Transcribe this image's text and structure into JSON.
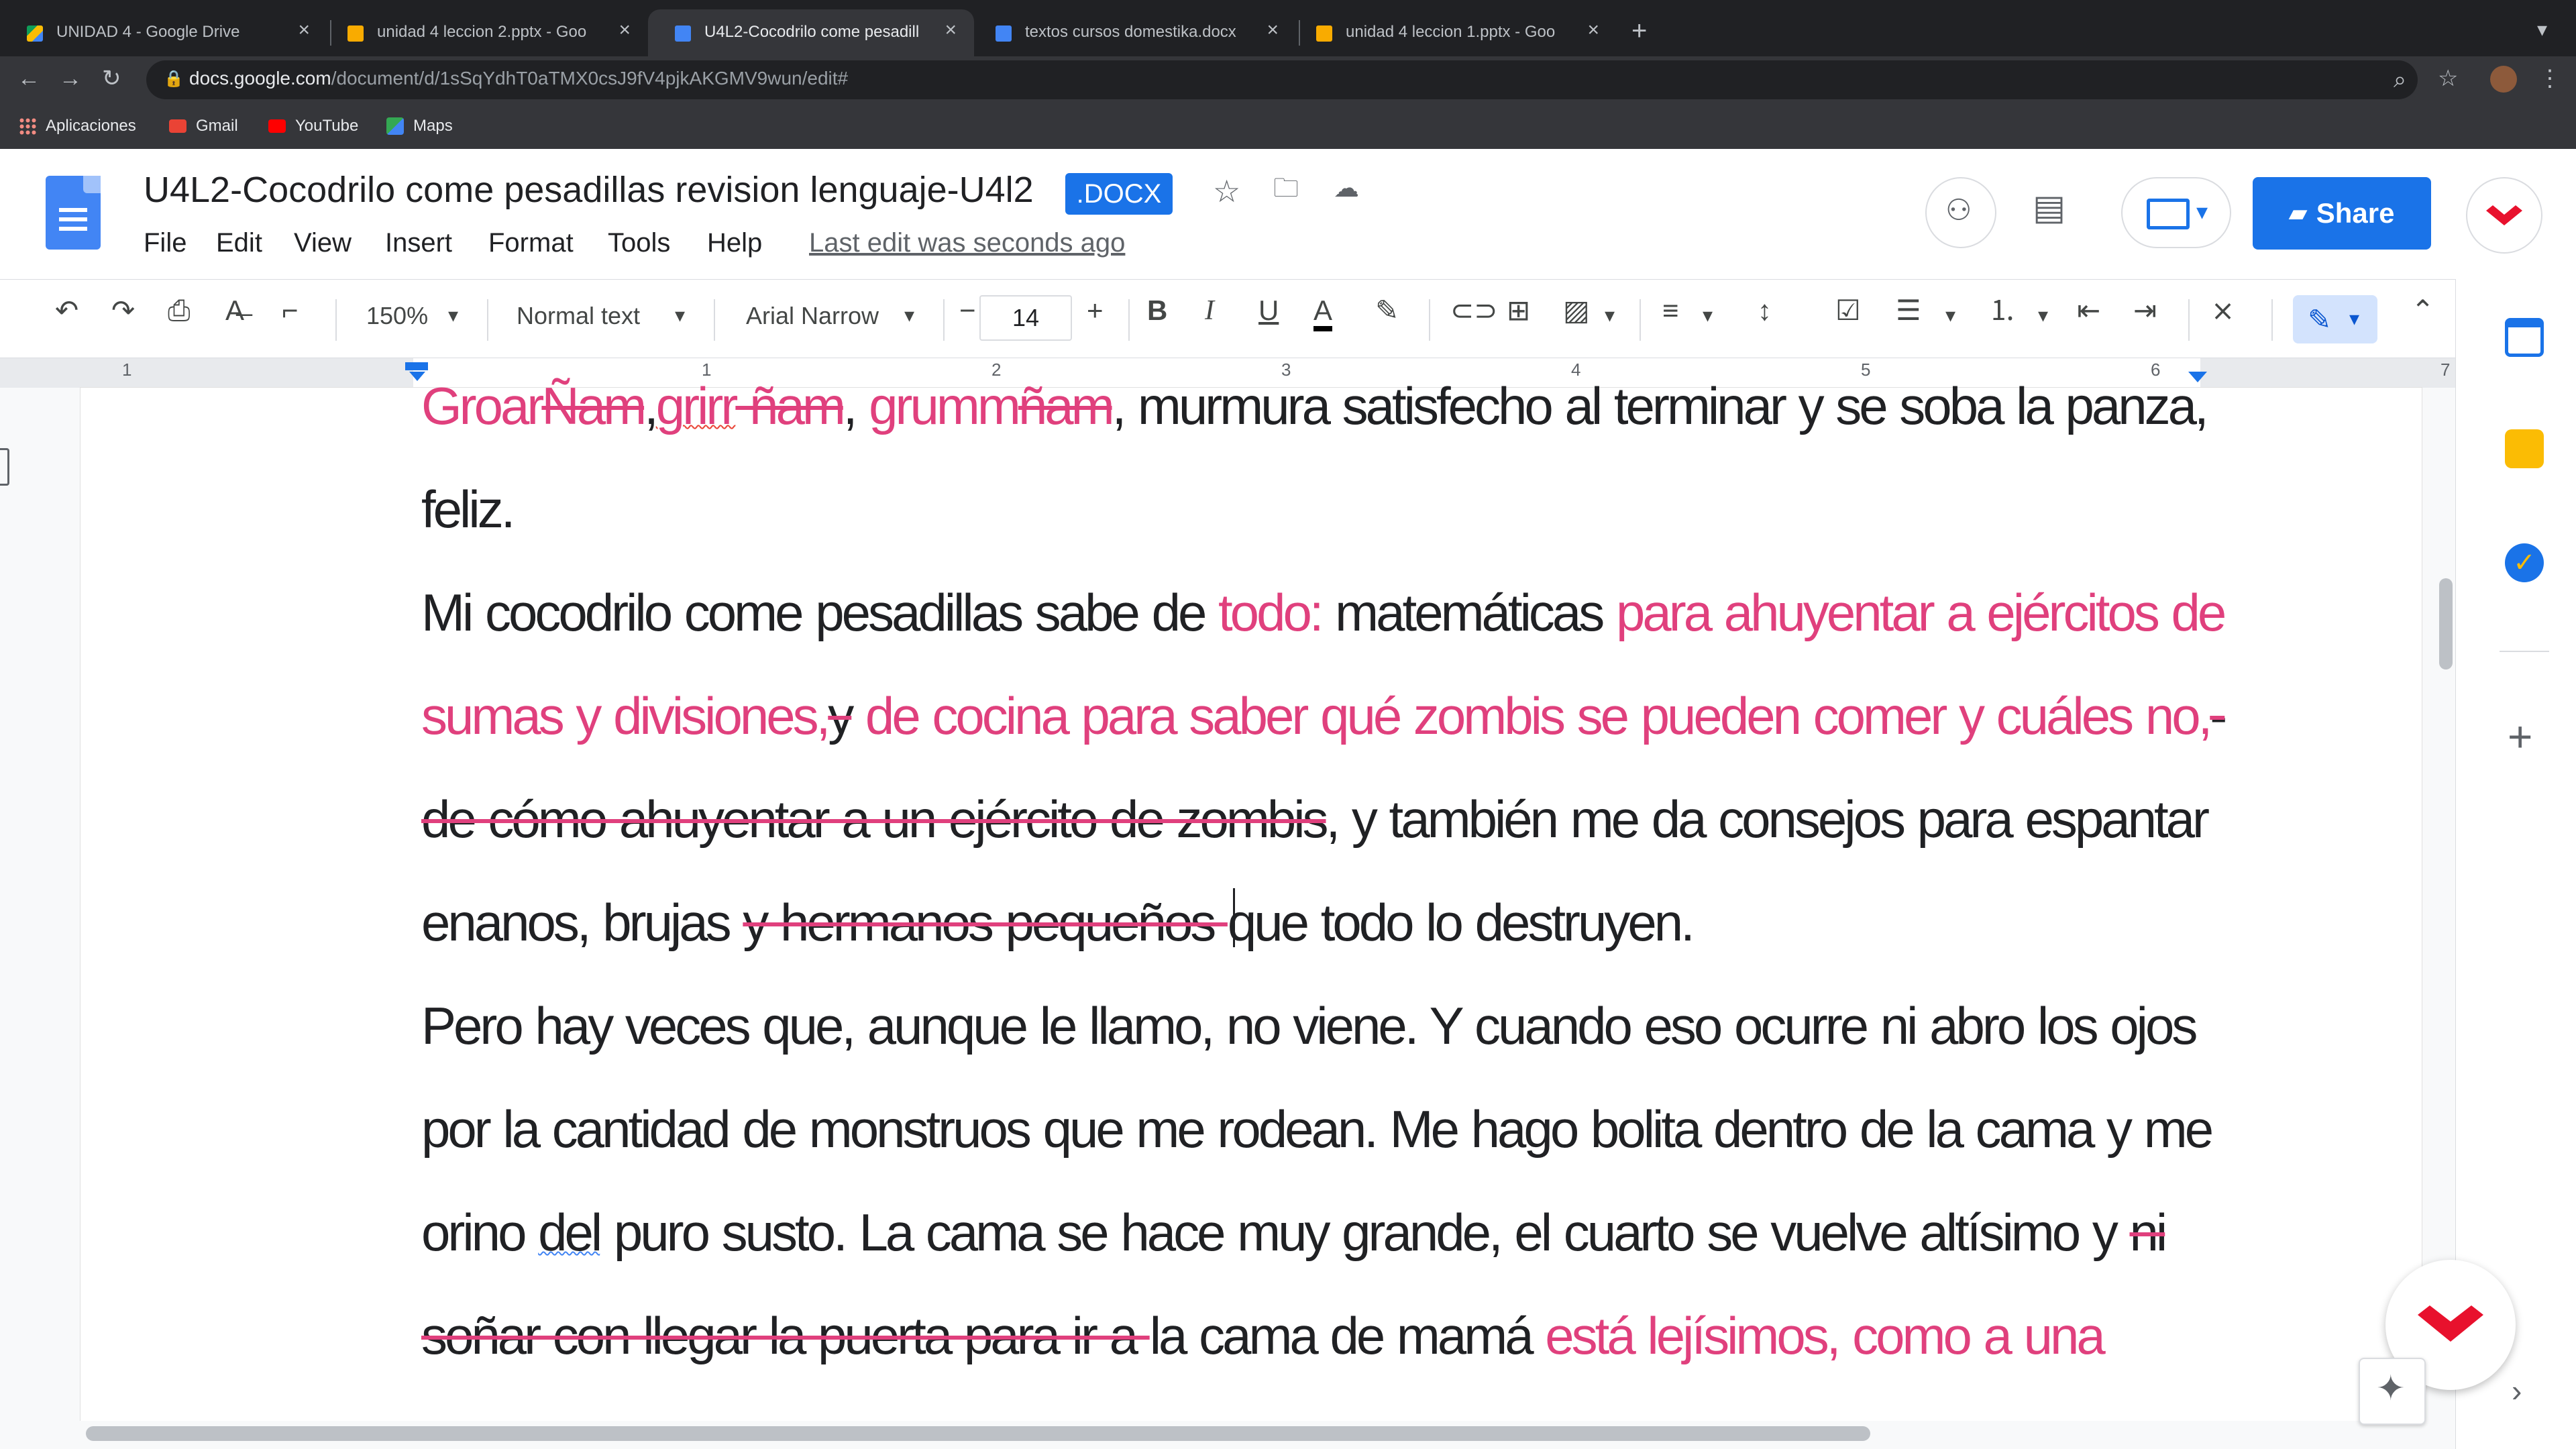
{
  "browser": {
    "tabs": [
      {
        "title": "UNIDAD 4 - Google Drive",
        "favicon": "google-drive-icon",
        "active": false
      },
      {
        "title": "unidad 4 leccion 2.pptx - Goo",
        "favicon": "google-slides-icon",
        "active": false
      },
      {
        "title": "U4L2-Cocodrilo come pesadill",
        "favicon": "google-docs-icon",
        "active": true
      },
      {
        "title": "textos cursos domestika.docx",
        "favicon": "google-docs-icon",
        "active": false
      },
      {
        "title": "unidad 4 leccion 1.pptx - Goo",
        "favicon": "google-slides-icon",
        "active": false
      }
    ],
    "new_tab": "+",
    "close_glyph": "×",
    "url_host": "docs.google.com",
    "url_path": "/document/d/1sSqYdhT0aTMX0csJ9fV4pjkAKGMV9wun/edit#",
    "bookmarks": [
      "Aplicaciones",
      "Gmail",
      "YouTube",
      "Maps"
    ]
  },
  "doc": {
    "title": "U4L2-Cocodrilo come pesadillas revision lenguaje-U4l2",
    "badge": ".DOCX",
    "menu": [
      "File",
      "Edit",
      "View",
      "Insert",
      "Format",
      "Tools",
      "Help"
    ],
    "last_edit": "Last edit was seconds ago",
    "share_label": "Share"
  },
  "toolbar": {
    "zoom": "150%",
    "style": "Normal text",
    "font": "Arial Narrow",
    "font_size": "14",
    "minus": "−",
    "plus": "+",
    "bold": "B",
    "italic": "I",
    "underline": "U",
    "text_color": "A"
  },
  "ruler": {
    "numbers": [
      "1",
      "1",
      "2",
      "3",
      "4",
      "5",
      "6",
      "7"
    ]
  },
  "body": {
    "line1": [
      {
        "t": "Groar",
        "s": "ins"
      },
      {
        "t": "Ñam",
        "s": "delpink"
      },
      {
        "t": ",",
        "s": "n"
      },
      {
        "t": "grirr",
        "s": "inswavy"
      },
      {
        "t": " ñam",
        "s": "delpink"
      },
      {
        "t": ", ",
        "s": "n"
      },
      {
        "t": "grumm",
        "s": "ins"
      },
      {
        "t": "ñam",
        "s": "delpink"
      },
      {
        "t": ", murmura satisfecho al terminar y se soba la panza,",
        "s": "n"
      }
    ],
    "line2": "feliz.",
    "line3": [
      {
        "t": "Mi cocodrilo come pesadillas sabe de ",
        "s": "n"
      },
      {
        "t": "todo:",
        "s": "ins"
      },
      {
        "t": " matemáticas ",
        "s": "n"
      },
      {
        "t": "para ahuyentar a ejércitos de",
        "s": "ins"
      }
    ],
    "line4": [
      {
        "t": "sumas y divisiones,",
        "s": "ins"
      },
      {
        "t": "y",
        "s": "del"
      },
      {
        "t": " de cocina para saber qué zombis se pueden comer y cuáles no,",
        "s": "ins"
      },
      {
        "t": "-",
        "s": "del"
      }
    ],
    "line5": [
      {
        "t": "de cómo ahuyentar a un ejército de zombis",
        "s": "del"
      },
      {
        "t": ", y también me da consejos para espantar",
        "s": "n"
      }
    ],
    "line6": [
      {
        "t": "enanos, brujas ",
        "s": "n"
      },
      {
        "t": "y hermanos pequeños ",
        "s": "del"
      },
      {
        "t": "que todo lo destruyen.",
        "s": "n"
      }
    ],
    "line7": "Pero hay veces que, aunque le llamo, no viene. Y cuando eso ocurre ni abro los ojos",
    "line8": "por la cantidad de monstruos que me rodean. Me hago bolita dentro de la cama y me",
    "line9": [
      {
        "t": "orino ",
        "s": "n"
      },
      {
        "t": "del",
        "s": "wavyblue"
      },
      {
        "t": " puro susto. La cama se hace muy grande, el cuarto se vuelve altísimo y ",
        "s": "n"
      },
      {
        "t": "ni",
        "s": "del"
      }
    ],
    "line10": [
      {
        "t": "soñar con llegar la puerta para ir a ",
        "s": "del"
      },
      {
        "t": "la cama de mamá ",
        "s": "n"
      },
      {
        "t": "está lejísimos, como a una",
        "s": "ins"
      }
    ]
  },
  "colors": {
    "suggestion": "#e0407d",
    "accent": "#1a73e8"
  }
}
